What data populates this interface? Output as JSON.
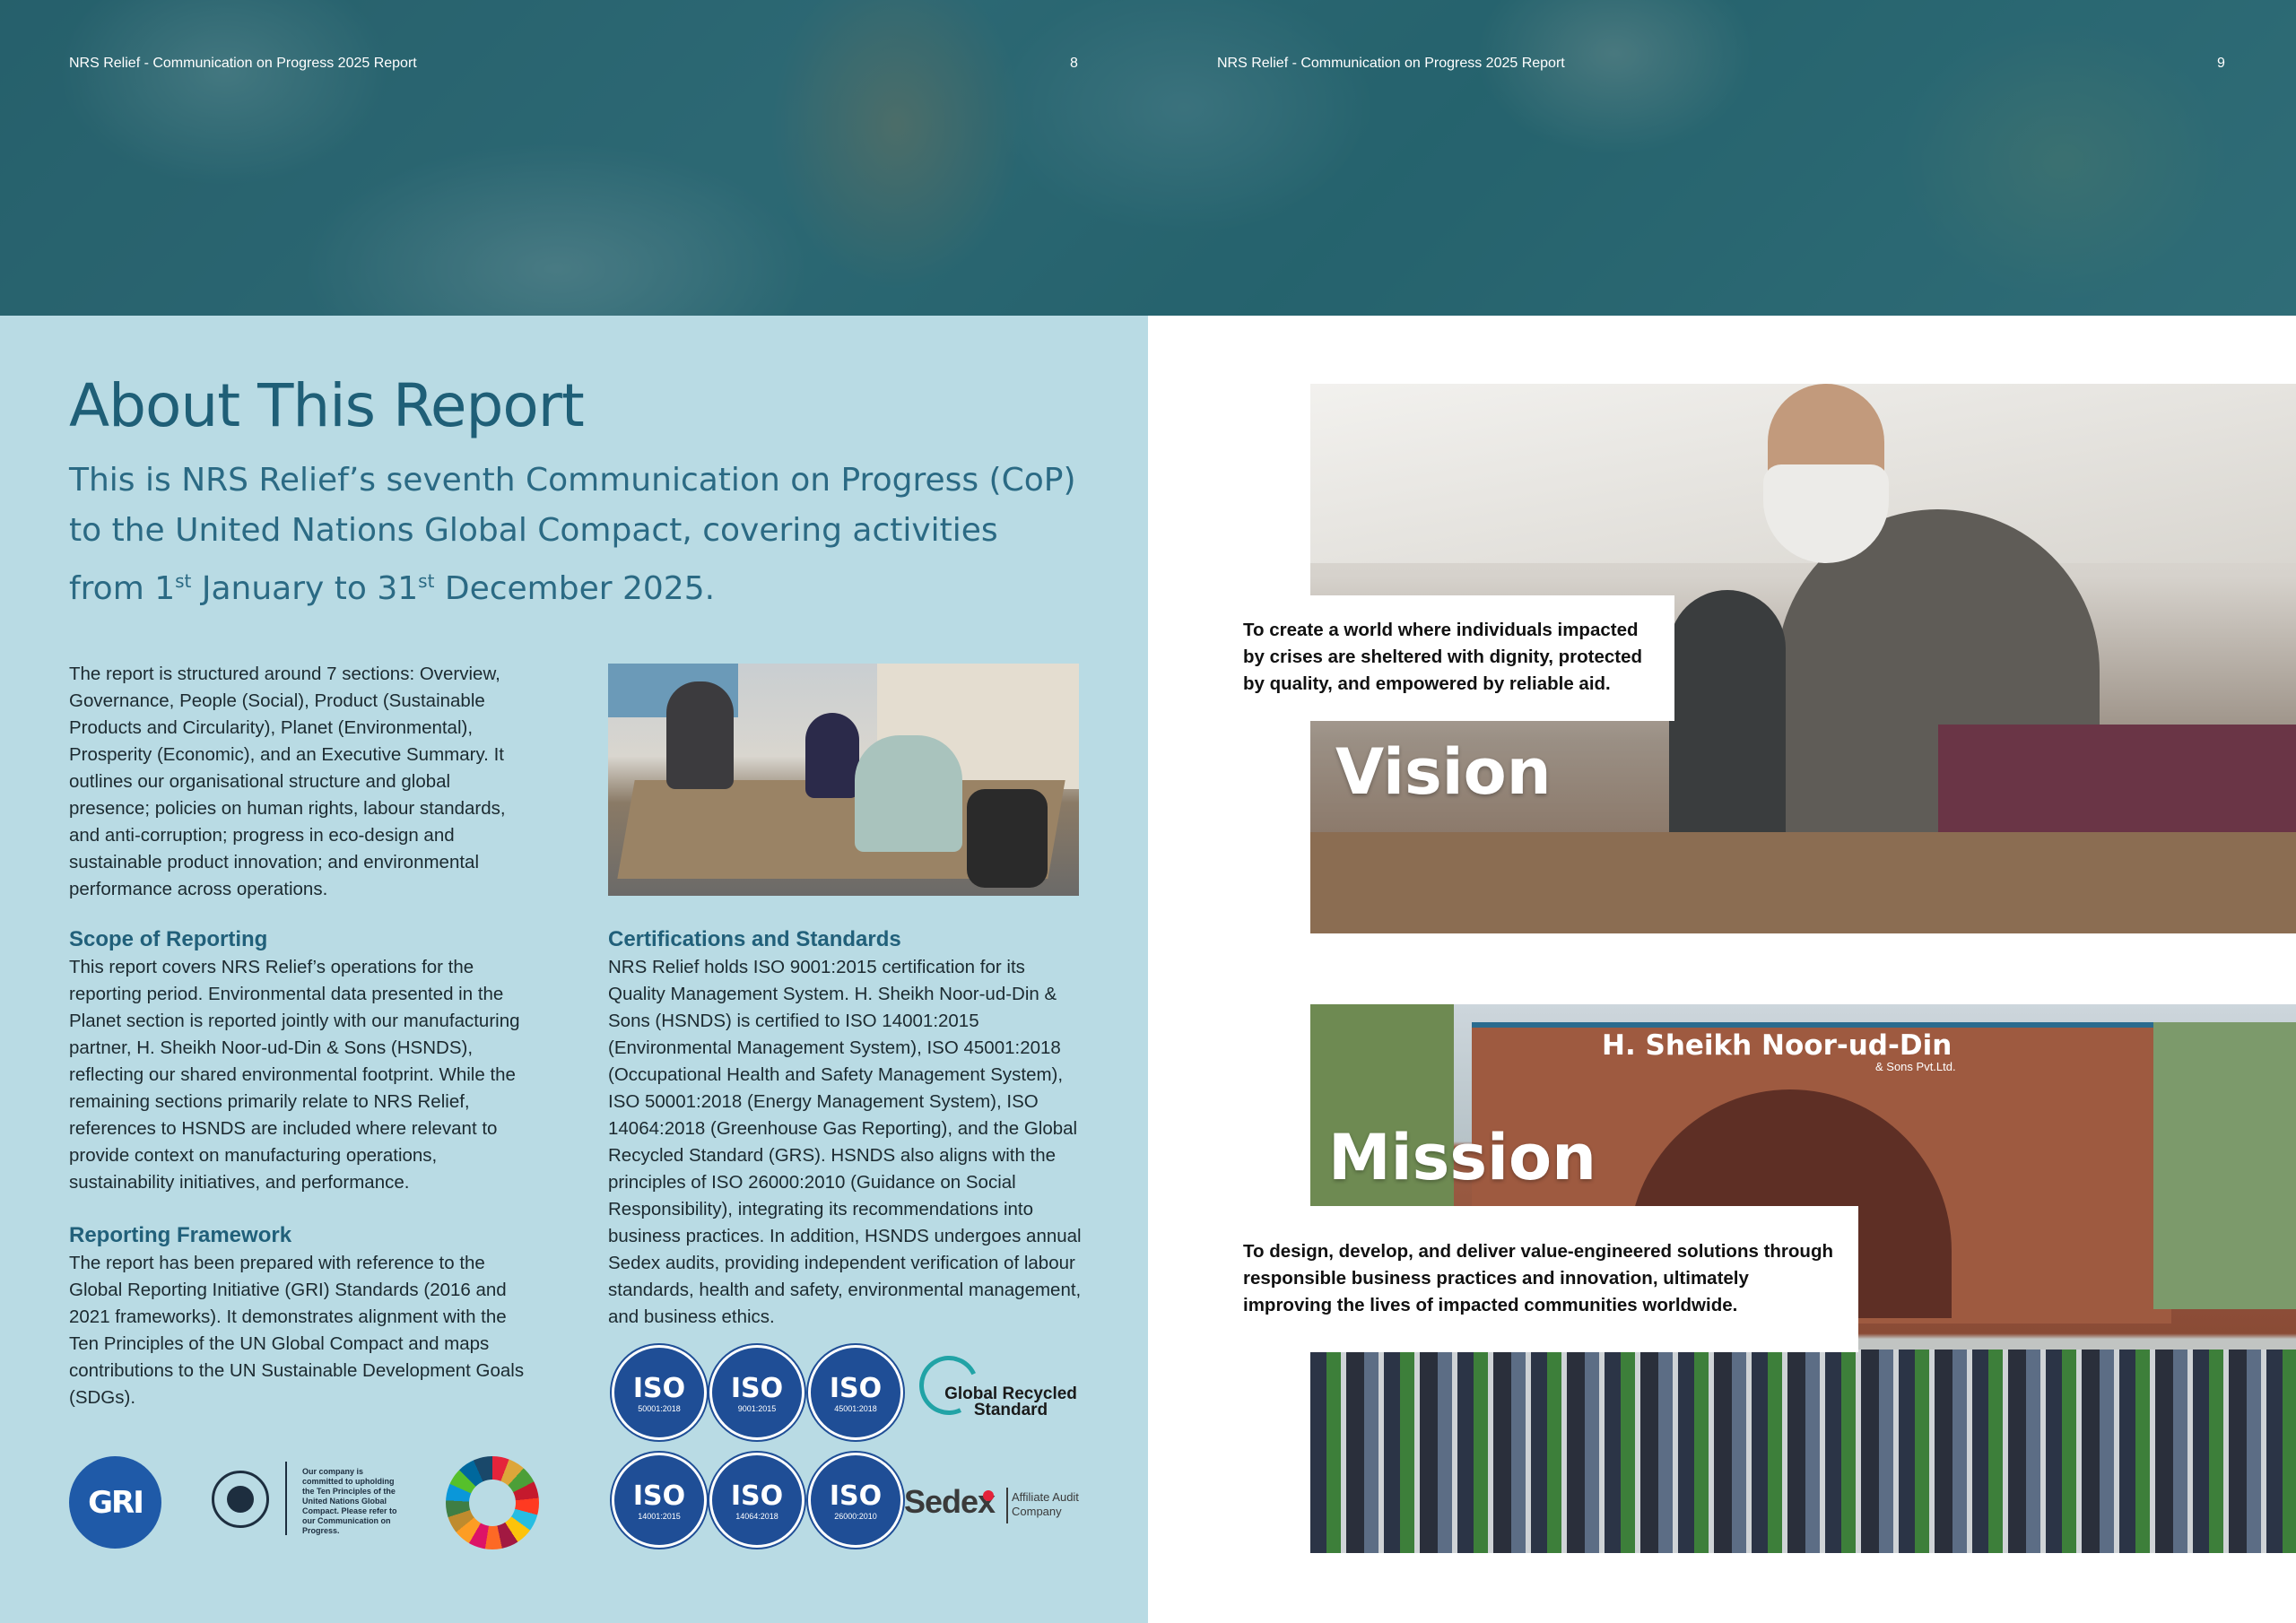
{
  "header": {
    "left_title": "NRS Relief - Communication on Progress 2025 Report",
    "left_page": "8",
    "right_title": "NRS Relief - Communication on Progress 2025 Report",
    "right_page": "9"
  },
  "about": {
    "title": "About This Report",
    "lead_1": "This is NRS Relief’s seventh Communication on Progress (CoP) to the United Nations Global Compact, covering activities from 1",
    "lead_sup_1": "st",
    "lead_2": " January to 31",
    "lead_sup_2": "st",
    "lead_3": " December 2025.",
    "intro": "The report is structured around 7 sections: Overview, Governance, People (Social), Product (Sustainable Products and Circularity), Planet (Environmental), Prosperity (Economic), and an Executive Summary. It outlines our organisational structure and global presence; policies on human rights, labour standards, and anti-corruption; progress in eco-design and sustainable product innovation; and environmental performance across operations."
  },
  "scope": {
    "heading": "Scope of Reporting",
    "text": "This report covers NRS Relief’s operations for the reporting period. Environmental data presented in the Planet section is reported jointly with our manufacturing partner, H. Sheikh Noor-ud-Din & Sons (HSNDS), reflecting our shared environmental footprint. While the remaining sections primarily relate to NRS Relief, references to HSNDS are included where relevant to provide context on manufacturing operations, sustainability initiatives, and performance."
  },
  "framework": {
    "heading": "Reporting Framework",
    "text": "The report has been prepared with reference to the Global Reporting Initiative (GRI) Standards (2016 and 2021 frameworks). It demonstrates alignment with the Ten Principles of the UN Global Compact and maps contributions to the UN Sustainable Development Goals (SDGs)."
  },
  "certs": {
    "heading": "Certifications and Standards",
    "text": "NRS Relief holds ISO 9001:2015 certification for its Quality Management System. H. Sheikh Noor-ud-Din & Sons (HSNDS) is certified to ISO 14001:2015 (Environmental Management System), ISO 45001:2018 (Occupational Health and Safety Management System), ISO 50001:2018 (Energy Management System), ISO 14064:2018 (Greenhouse Gas Reporting), and the Global Recycled Standard (GRS). HSNDS also aligns with the principles of ISO 26000:2010 (Guidance on Social Responsibility), integrating its recommendations into business practices. In addition, HSNDS undergoes annual Sedex audits, providing independent verification of labour standards, health and safety, environmental management, and business ethics."
  },
  "badges": {
    "iso_label": "ISO",
    "row1": [
      "50001:2018",
      "9001:2015",
      "45001:2018"
    ],
    "row2": [
      "14001:2015",
      "14064:2018",
      "26000:2010"
    ],
    "grs": "Global Recycled Standard",
    "sedex": "Sedex",
    "sedex_sub": "Affiliate Audit Company"
  },
  "logos": {
    "gri": "GRI",
    "ungc_text": "Our company is committed to upholding the Ten Principles of the United Nations Global Compact. Please refer to our Communication on Progress."
  },
  "vision": {
    "word": "Vision",
    "text": "To create a world where individuals impacted by crises are sheltered with dignity, protected by quality, and empowered by reliable aid."
  },
  "mission": {
    "word": "Mission",
    "text": "To design, develop, and deliver value-engineered solutions through responsible business practices and innovation, ultimately improving the lives of impacted communities worldwide.",
    "sign": "H. Sheikh Noor-ud-Din",
    "sign_sub": "& Sons Pvt.Ltd."
  }
}
